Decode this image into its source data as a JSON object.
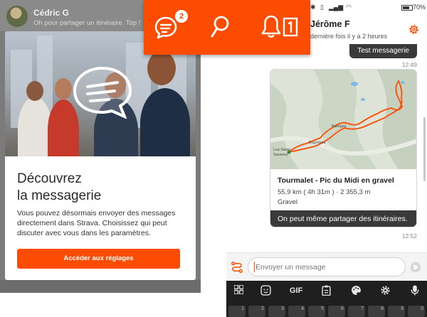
{
  "left_screen": {
    "contact_name": "Cédric G",
    "last_message_snippet": "Oh pour partager un itinéraire. Top !"
  },
  "modal": {
    "title": "Découvrez\nla messagerie",
    "body": "Vous pouvez désormais envoyer des messages directement dans Strava. Choisissez qui peut discuter avec vous dans les paramètres.",
    "cta_label": "Accéder aux réglages"
  },
  "banner": {
    "badge_count": "2",
    "icons": [
      "messages-icon",
      "search-icon",
      "notifications-icon"
    ],
    "accent": "#fc4c02"
  },
  "status_bar": {
    "battery": "70"
  },
  "chat": {
    "header": {
      "name": "Jérôme F",
      "last_seen": "dernière fois il y a 2 heures"
    },
    "messages": [
      {
        "text": "Test messagerie",
        "time": "12:49"
      },
      {
        "route": {
          "name": "Tourmalet - Pic du Midi en gravel",
          "stats": "55,9 km ( 4h 31m ) · 2 355,3 m",
          "type": "Gravel",
          "map_labels": [
            "Luz-Saint-Sauveur",
            "Barèges",
            "Bagnères"
          ]
        },
        "text": "On peut même partager des itinéraires.",
        "time": "12:52"
      }
    ],
    "composer": {
      "placeholder": "Envoyer un message"
    }
  },
  "keyboard": {
    "tools": [
      "grid-icon",
      "sticker-icon",
      "GIF",
      "clipboard-icon",
      "palette-icon",
      "gear-icon",
      "mic-icon"
    ],
    "gif_label": "GIF",
    "row_sup": [
      "1",
      "2",
      "3",
      "4",
      "5",
      "6",
      "7",
      "8",
      "9",
      "0"
    ]
  }
}
